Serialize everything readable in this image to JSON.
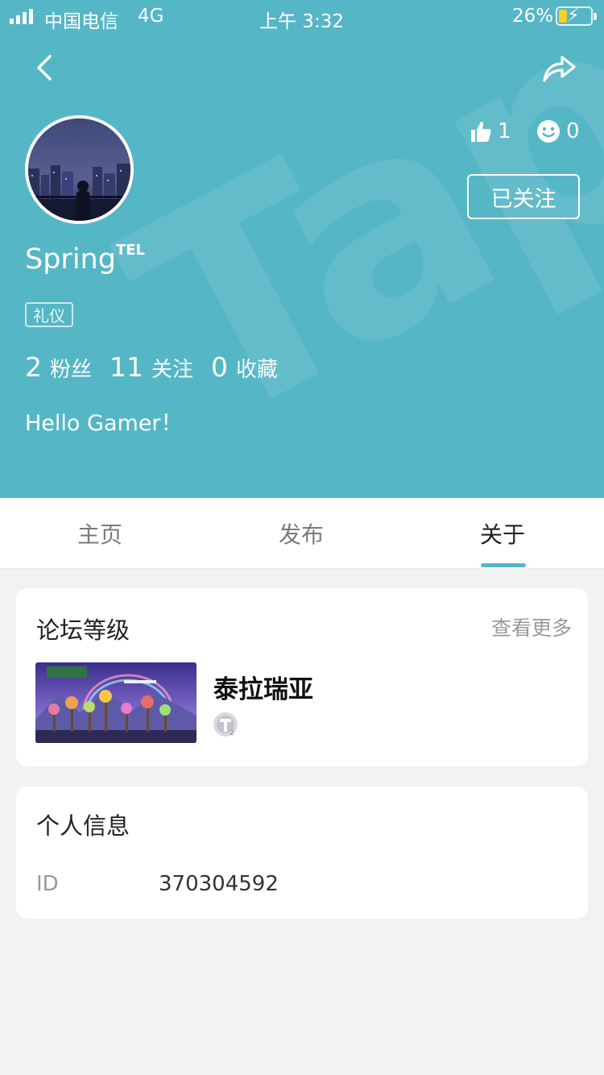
{
  "status_bar": {
    "carrier": "中国电信",
    "network": "4G",
    "time": "上午 3:32",
    "battery_percent": "26%",
    "battery_level": 0.26
  },
  "header": {
    "background_color": "#55b6c6",
    "back_icon": "chevron-left-icon",
    "share_icon": "share-arrow-icon"
  },
  "profile": {
    "username": "Spring",
    "username_sup": "TEL",
    "tag": "礼仪",
    "likes": "1",
    "emoji_count": "0",
    "follow_button_label": "已关注",
    "stats": [
      {
        "value": "2",
        "label": "粉丝"
      },
      {
        "value": "11",
        "label": "关注"
      },
      {
        "value": "0",
        "label": "收藏"
      }
    ],
    "bio": "Hello Gamer！"
  },
  "tabs": [
    {
      "label": "主页",
      "active": false
    },
    {
      "label": "发布",
      "active": false
    },
    {
      "label": "关于",
      "active": true
    }
  ],
  "forum_level": {
    "title": "论坛等级",
    "see_more": "查看更多",
    "game_name": "泰拉瑞亚",
    "badge_icon": "level-badge-icon"
  },
  "personal_info": {
    "title": "个人信息",
    "id_label": "ID",
    "id_value": "370304592"
  }
}
